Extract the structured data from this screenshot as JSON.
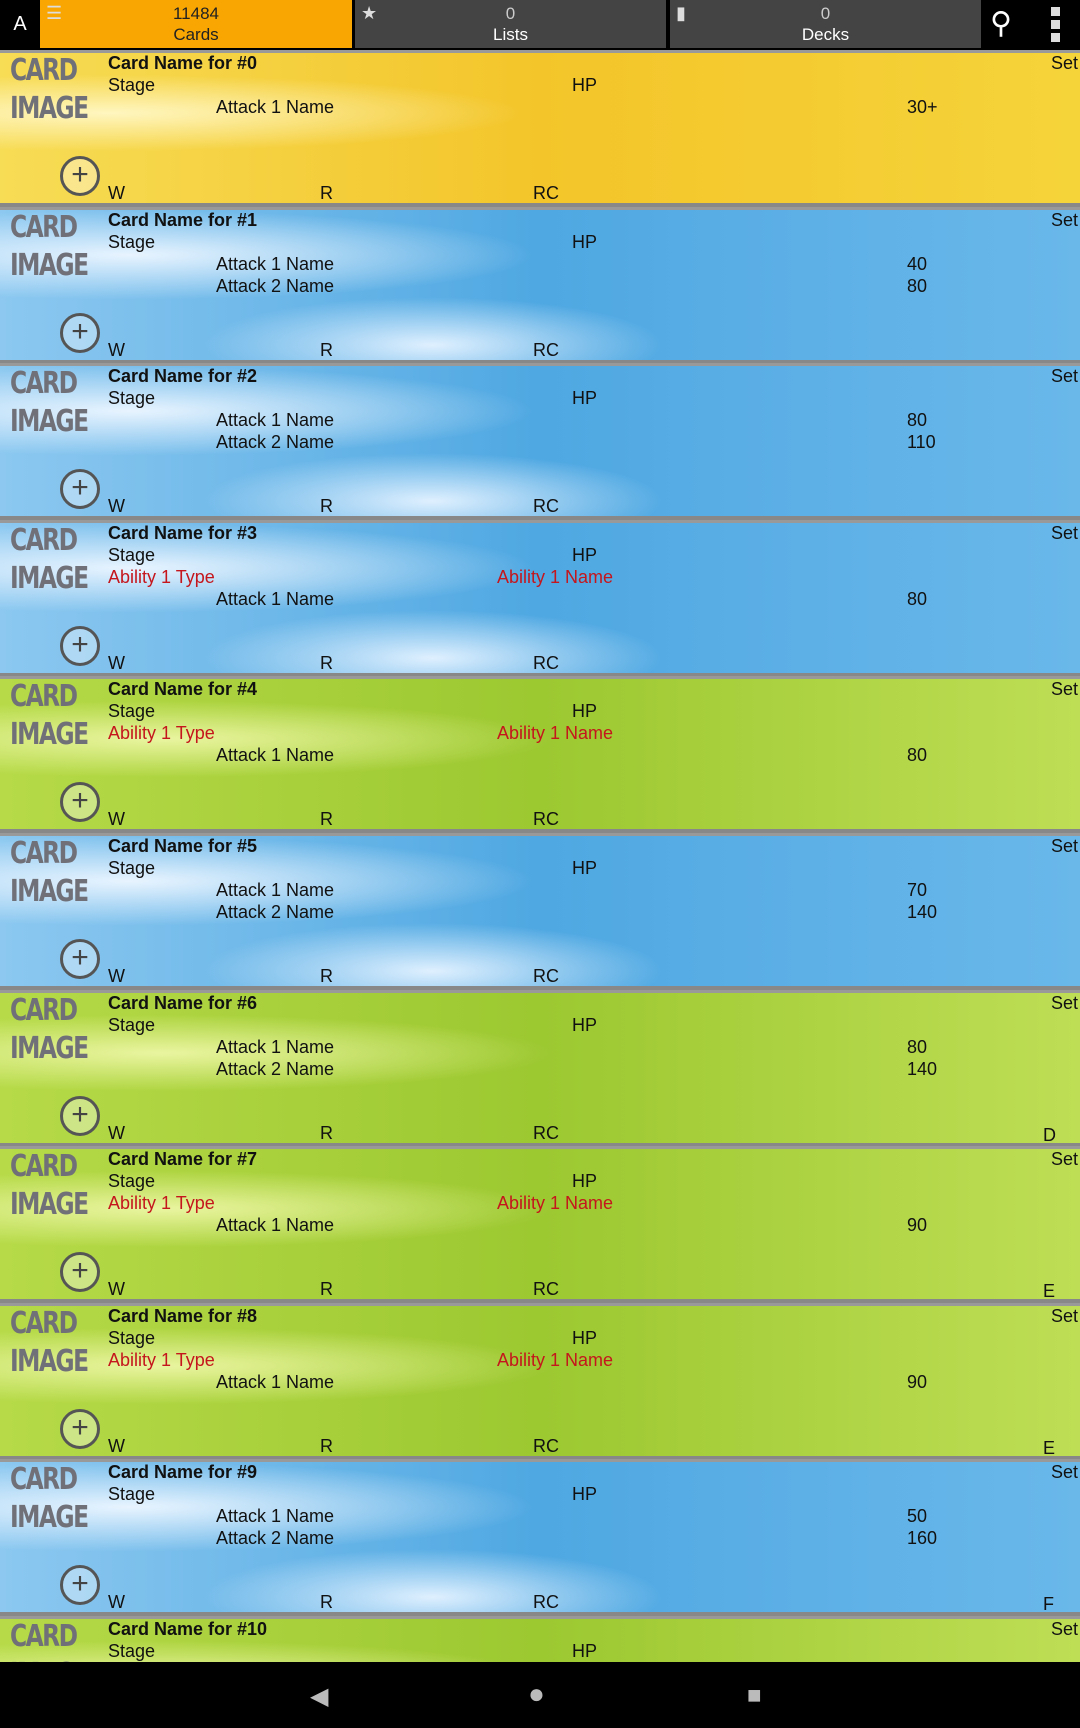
{
  "header": {
    "alpha_label": "A",
    "tabs": [
      {
        "count": "11484",
        "label": "Cards",
        "icon": "list-icon"
      },
      {
        "count": "0",
        "label": "Lists",
        "icon": "star-icon"
      },
      {
        "count": "0",
        "label": "Decks",
        "icon": "deck-icon"
      }
    ],
    "search_icon": "search-icon",
    "more_icon": "more-vert-icon"
  },
  "colors": {
    "active_tab": "#f9a602",
    "inactive_tab": "#444444",
    "ability_text": "#c4161c"
  },
  "card_image_label": [
    "CARD",
    "IMAGE"
  ],
  "cards": [
    {
      "name": "Card Name for #0",
      "stage": "Stage",
      "hp": "HP",
      "set": "Set",
      "theme": "yellow",
      "ability": null,
      "attacks": [
        {
          "name": "Attack 1 Name",
          "damage": "30+"
        }
      ],
      "w": "W",
      "r": "R",
      "rc": "RC",
      "rarity": ""
    },
    {
      "name": "Card Name for #1",
      "stage": "Stage",
      "hp": "HP",
      "set": "Set",
      "theme": "blue",
      "ability": null,
      "attacks": [
        {
          "name": "Attack 1 Name",
          "damage": "40"
        },
        {
          "name": "Attack 2 Name",
          "damage": "80"
        }
      ],
      "w": "W",
      "r": "R",
      "rc": "RC",
      "rarity": ""
    },
    {
      "name": "Card Name for #2",
      "stage": "Stage",
      "hp": "HP",
      "set": "Set",
      "theme": "blue",
      "ability": null,
      "attacks": [
        {
          "name": "Attack 1 Name",
          "damage": "80"
        },
        {
          "name": "Attack 2 Name",
          "damage": "110"
        }
      ],
      "w": "W",
      "r": "R",
      "rc": "RC",
      "rarity": ""
    },
    {
      "name": "Card Name for #3",
      "stage": "Stage",
      "hp": "HP",
      "set": "Set",
      "theme": "blue",
      "ability": {
        "type": "Ability 1 Type",
        "name": "Ability 1 Name"
      },
      "attacks": [
        {
          "name": "Attack 1 Name",
          "damage": "80"
        }
      ],
      "w": "W",
      "r": "R",
      "rc": "RC",
      "rarity": ""
    },
    {
      "name": "Card Name for #4",
      "stage": "Stage",
      "hp": "HP",
      "set": "Set",
      "theme": "green",
      "ability": {
        "type": "Ability 1 Type",
        "name": "Ability 1 Name"
      },
      "attacks": [
        {
          "name": "Attack 1 Name",
          "damage": "80"
        }
      ],
      "w": "W",
      "r": "R",
      "rc": "RC",
      "rarity": ""
    },
    {
      "name": "Card Name for #5",
      "stage": "Stage",
      "hp": "HP",
      "set": "Set",
      "theme": "blue",
      "ability": null,
      "attacks": [
        {
          "name": "Attack 1 Name",
          "damage": "70"
        },
        {
          "name": "Attack 2 Name",
          "damage": "140"
        }
      ],
      "w": "W",
      "r": "R",
      "rc": "RC",
      "rarity": ""
    },
    {
      "name": "Card Name for #6",
      "stage": "Stage",
      "hp": "HP",
      "set": "Set",
      "theme": "green",
      "ability": null,
      "attacks": [
        {
          "name": "Attack 1 Name",
          "damage": "80"
        },
        {
          "name": "Attack 2 Name",
          "damage": "140"
        }
      ],
      "w": "W",
      "r": "R",
      "rc": "RC",
      "rarity": "D"
    },
    {
      "name": "Card Name for #7",
      "stage": "Stage",
      "hp": "HP",
      "set": "Set",
      "theme": "green",
      "ability": {
        "type": "Ability 1 Type",
        "name": "Ability 1 Name"
      },
      "attacks": [
        {
          "name": "Attack 1 Name",
          "damage": "90"
        }
      ],
      "w": "W",
      "r": "R",
      "rc": "RC",
      "rarity": "E"
    },
    {
      "name": "Card Name for #8",
      "stage": "Stage",
      "hp": "HP",
      "set": "Set",
      "theme": "green",
      "ability": {
        "type": "Ability 1 Type",
        "name": "Ability 1 Name"
      },
      "attacks": [
        {
          "name": "Attack 1 Name",
          "damage": "90"
        }
      ],
      "w": "W",
      "r": "R",
      "rc": "RC",
      "rarity": "E"
    },
    {
      "name": "Card Name for #9",
      "stage": "Stage",
      "hp": "HP",
      "set": "Set",
      "theme": "blue",
      "ability": null,
      "attacks": [
        {
          "name": "Attack 1 Name",
          "damage": "50"
        },
        {
          "name": "Attack 2 Name",
          "damage": "160"
        }
      ],
      "w": "W",
      "r": "R",
      "rc": "RC",
      "rarity": "F"
    },
    {
      "name": "Card Name for #10",
      "stage": "Stage",
      "hp": "HP",
      "set": "Set",
      "theme": "green",
      "ability": null,
      "attacks": [],
      "w": "",
      "r": "",
      "rc": "",
      "rarity": ""
    }
  ],
  "navbar": {
    "back_icon": "back-icon",
    "home_icon": "home-icon",
    "recents_icon": "recents-icon"
  }
}
